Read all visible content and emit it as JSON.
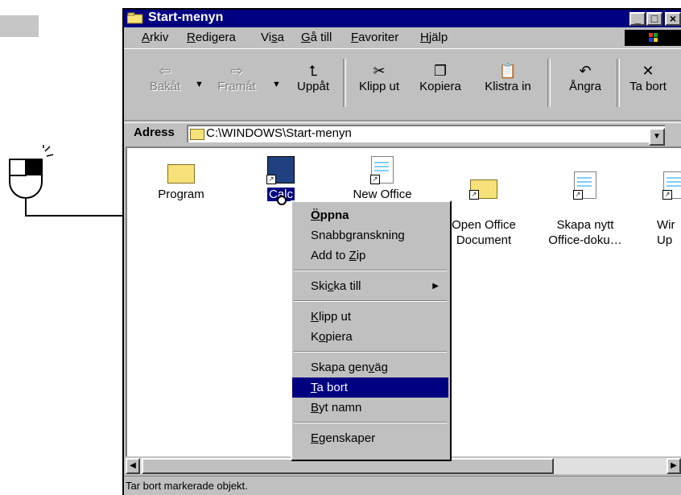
{
  "window": {
    "title": "Start-menyn"
  },
  "title_buttons": {
    "min": "_",
    "max": "□",
    "close": "×"
  },
  "menu": [
    {
      "label": "Arkiv",
      "accel": "A"
    },
    {
      "label": "Redigera",
      "accel": "R"
    },
    {
      "label": "Visa",
      "accel": "s"
    },
    {
      "label": "Gå till",
      "accel": "G"
    },
    {
      "label": "Favoriter",
      "accel": "F"
    },
    {
      "label": "Hjälp",
      "accel": "H"
    }
  ],
  "toolbar": {
    "back": "Bakåt",
    "forward": "Framåt",
    "up": "Uppåt",
    "cut": "Klipp ut",
    "copy": "Kopiera",
    "paste": "Klistra in",
    "undo": "Ångra",
    "delete": "Ta bort"
  },
  "address": {
    "label": "Adress",
    "value": "C:\\WINDOWS\\Start-menyn"
  },
  "items": [
    {
      "label": "Program",
      "icon": "program-folder-icon"
    },
    {
      "label": "Calc",
      "icon": "calc-shortcut-icon",
      "selected": true
    },
    {
      "label": "New Office",
      "icon": "document-shortcut-icon"
    },
    {
      "label": "Open Office\nDocument",
      "icon": "open-folder-shortcut-icon"
    },
    {
      "label": "Skapa nytt\nOffice-doku…",
      "icon": "document-shortcut-icon"
    },
    {
      "label": "Wir\nUp",
      "icon": "windows-update-icon"
    }
  ],
  "context_menu": {
    "open": "Öppna",
    "quickview": "Snabbgranskning",
    "add_zip": "Add to Zip",
    "send_to": "Skicka till",
    "cut": "Klipp ut",
    "copy": "Kopiera",
    "shortcut": "Skapa genväg",
    "delete": "Ta bort",
    "rename": "Byt namn",
    "properties": "Egenskaper"
  },
  "status": "Tar bort markerade objekt.",
  "colors": {
    "titlebar": "#000080",
    "highlight": "#000080",
    "face": "#c0c0c0"
  }
}
